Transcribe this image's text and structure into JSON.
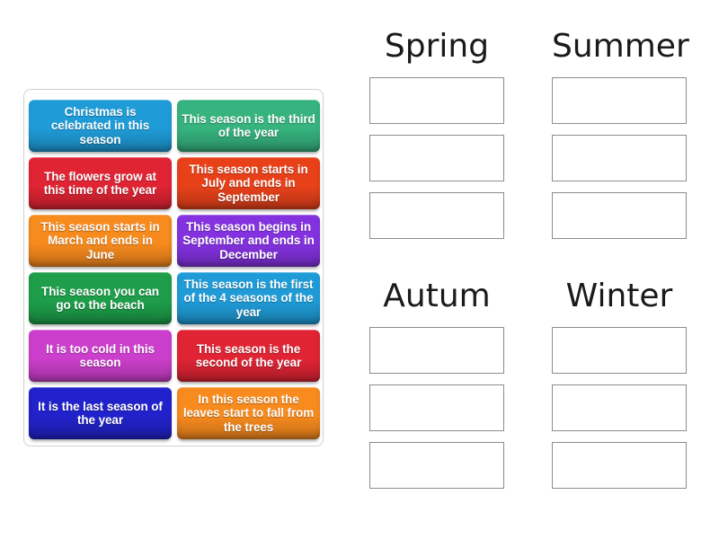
{
  "activity": {
    "type": "drag-and-drop-sorting",
    "cards_panel_label": "Draggable description cards"
  },
  "cards": [
    {
      "id": "card-christmas",
      "text": "Christmas is celebrated in this season",
      "color": "#1f9cd8",
      "column": "left",
      "row": 0
    },
    {
      "id": "card-third-of-year",
      "text": "This season is the third of the year",
      "color": "#36b37e",
      "column": "right",
      "row": 0
    },
    {
      "id": "card-flowers-grow",
      "text": "The flowers grow at this time of the year",
      "color": "#e02434",
      "column": "left",
      "row": 1
    },
    {
      "id": "card-july-september",
      "text": "This season starts in July and ends in September",
      "color": "#e8411a",
      "column": "right",
      "row": 1
    },
    {
      "id": "card-march-june",
      "text": "This season starts in March and ends in June",
      "color": "#f78b1e",
      "column": "left",
      "row": 2
    },
    {
      "id": "card-september-december",
      "text": "This season begins in September and ends in December",
      "color": "#8432e0",
      "column": "right",
      "row": 2
    },
    {
      "id": "card-beach",
      "text": "This season you can go to the beach",
      "color": "#1e9e4a",
      "column": "left",
      "row": 3
    },
    {
      "id": "card-first-of-4",
      "text": "This season is the first of the 4 seasons of the year",
      "color": "#1f9cd8",
      "column": "right",
      "row": 3
    },
    {
      "id": "card-too-cold",
      "text": "It is too cold in this season",
      "color": "#cc3fcc",
      "column": "left",
      "row": 4
    },
    {
      "id": "card-second-of-year",
      "text": "This season is the second of the year",
      "color": "#e02434",
      "column": "right",
      "row": 4
    },
    {
      "id": "card-last-season",
      "text": "It is the last season of the year",
      "color": "#2222cc",
      "column": "left",
      "row": 5
    },
    {
      "id": "card-leaves-fall",
      "text": "In this season the leaves start to fall from the trees",
      "color": "#f78b1e",
      "column": "right",
      "row": 5
    }
  ],
  "categories": [
    {
      "id": "spring",
      "title": "Spring",
      "slots": 3
    },
    {
      "id": "summer",
      "title": "Summer",
      "slots": 3
    },
    {
      "id": "autum",
      "title": "Autum",
      "slots": 3
    },
    {
      "id": "winter",
      "title": "Winter",
      "slots": 3
    }
  ],
  "colors": {
    "panel_border": "#d0d0d0",
    "dropzone_border": "#8d8d8d",
    "background": "#ffffff",
    "title_text": "#1a1a1a",
    "card_text": "#ffffff"
  }
}
